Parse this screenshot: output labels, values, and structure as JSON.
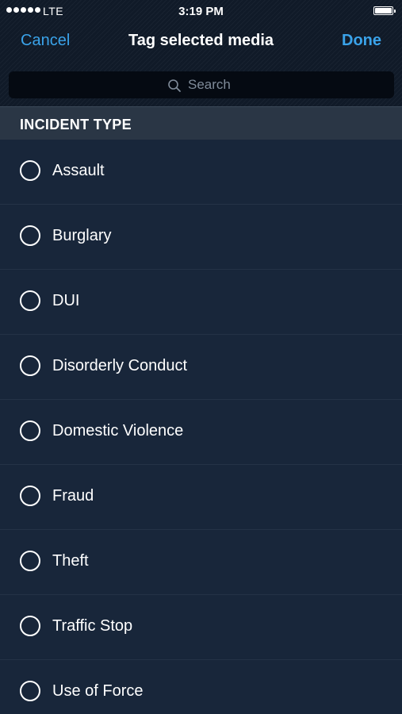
{
  "status_bar": {
    "carrier": "LTE",
    "time": "3:19 PM",
    "battery_level": 1.0
  },
  "nav": {
    "cancel_label": "Cancel",
    "title": "Tag selected media",
    "done_label": "Done"
  },
  "search": {
    "placeholder": "Search",
    "value": ""
  },
  "section": {
    "title": "INCIDENT TYPE"
  },
  "items": [
    {
      "label": "Assault",
      "selected": false
    },
    {
      "label": "Burglary",
      "selected": false
    },
    {
      "label": "DUI",
      "selected": false
    },
    {
      "label": "Disorderly Conduct",
      "selected": false
    },
    {
      "label": "Domestic Violence",
      "selected": false
    },
    {
      "label": "Fraud",
      "selected": false
    },
    {
      "label": "Theft",
      "selected": false
    },
    {
      "label": "Traffic Stop",
      "selected": false
    },
    {
      "label": "Use of Force",
      "selected": false
    }
  ],
  "colors": {
    "accent": "#3aa3ea",
    "background": "#18263a",
    "section_header": "#2a3645",
    "search_field": "#050a12"
  },
  "icons": {
    "search": "search-icon",
    "radio": "radio-unchecked-icon"
  }
}
